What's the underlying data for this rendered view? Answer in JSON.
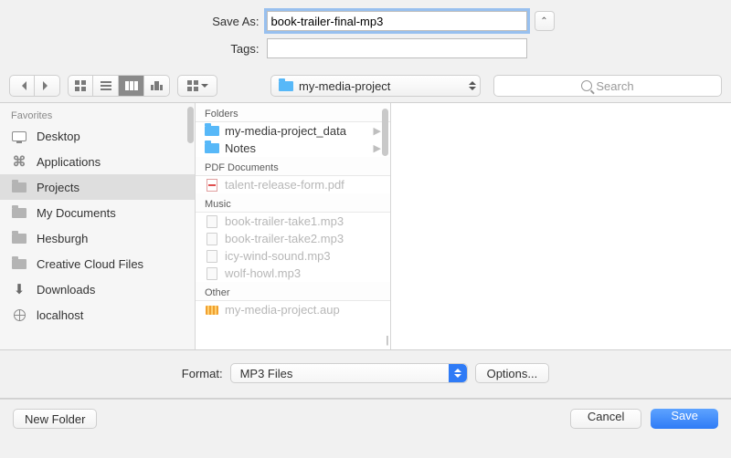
{
  "header": {
    "save_as_label": "Save As:",
    "save_as_value": "book-trailer-final-mp3",
    "tags_label": "Tags:",
    "tags_value": ""
  },
  "toolbar": {
    "path_folder": "my-media-project",
    "search_placeholder": "Search"
  },
  "sidebar": {
    "heading": "Favorites",
    "items": [
      {
        "label": "Desktop",
        "icon": "desktop"
      },
      {
        "label": "Applications",
        "icon": "applications"
      },
      {
        "label": "Projects",
        "icon": "folder",
        "selected": true
      },
      {
        "label": "My Documents",
        "icon": "folder"
      },
      {
        "label": "Hesburgh",
        "icon": "folder"
      },
      {
        "label": "Creative Cloud Files",
        "icon": "folder"
      },
      {
        "label": "Downloads",
        "icon": "downloads"
      },
      {
        "label": "localhost",
        "icon": "globe"
      }
    ]
  },
  "column": {
    "groups": [
      {
        "title": "Folders",
        "items": [
          {
            "label": "my-media-project_data",
            "icon": "folder-blue",
            "enabled": true,
            "hasChildren": true
          },
          {
            "label": "Notes",
            "icon": "folder-blue",
            "enabled": true,
            "hasChildren": true
          }
        ]
      },
      {
        "title": "PDF Documents",
        "items": [
          {
            "label": "talent-release-form.pdf",
            "icon": "pdf",
            "enabled": false
          }
        ]
      },
      {
        "title": "Music",
        "items": [
          {
            "label": "book-trailer-take1.mp3",
            "icon": "doc",
            "enabled": false
          },
          {
            "label": "book-trailer-take2.mp3",
            "icon": "doc",
            "enabled": false
          },
          {
            "label": "icy-wind-sound.mp3",
            "icon": "doc",
            "enabled": false
          },
          {
            "label": "wolf-howl.mp3",
            "icon": "doc",
            "enabled": false
          }
        ]
      },
      {
        "title": "Other",
        "items": [
          {
            "label": "my-media-project.aup",
            "icon": "aup",
            "enabled": false
          }
        ]
      }
    ]
  },
  "format": {
    "label": "Format:",
    "selected": "MP3 Files",
    "options_button": "Options..."
  },
  "footer": {
    "new_folder": "New Folder",
    "cancel": "Cancel",
    "save": "Save"
  }
}
